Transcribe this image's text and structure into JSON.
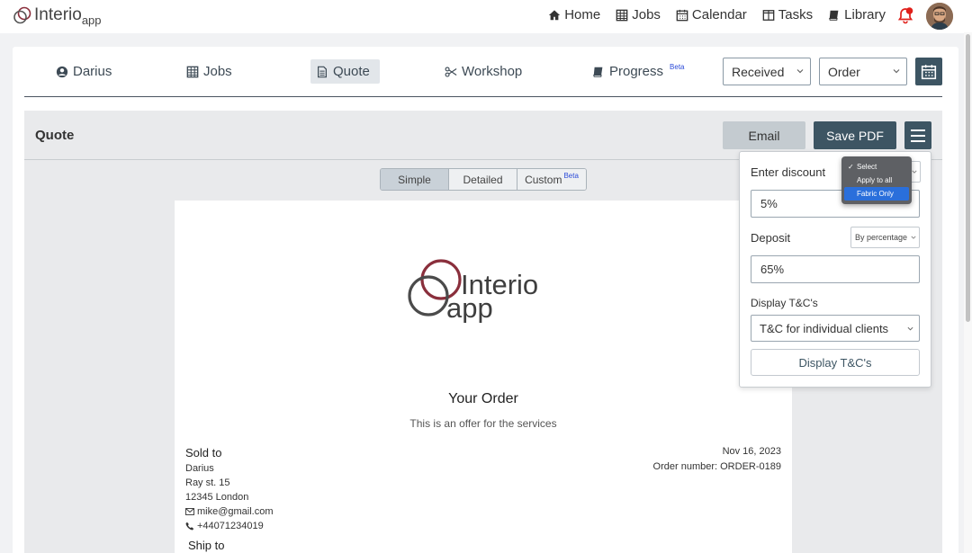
{
  "brand": {
    "name": "Interio",
    "suffix": "app"
  },
  "topnav": [
    {
      "label": "Home",
      "icon": "home-icon"
    },
    {
      "label": "Jobs",
      "icon": "table-icon"
    },
    {
      "label": "Calendar",
      "icon": "calendar-icon"
    },
    {
      "label": "Tasks",
      "icon": "columns-icon"
    },
    {
      "label": "Library",
      "icon": "book-icon"
    }
  ],
  "jobnav": {
    "client": "Darius",
    "jobs": "Jobs",
    "quote": "Quote",
    "workshop": "Workshop",
    "progress": "Progress",
    "beta": "Beta",
    "status_select": "Received",
    "type_select": "Order"
  },
  "quote": {
    "title": "Quote",
    "email_label": "Email",
    "pdf_label": "Save PDF",
    "modes": [
      "Simple",
      "Detailed",
      "Custom"
    ],
    "active_mode": "Simple",
    "custom_beta": "Beta"
  },
  "document": {
    "logo_name": "Interio",
    "logo_suffix": "app",
    "heading": "Your Order",
    "subheading": "This is an offer for the services",
    "sold_to_label": "Sold to",
    "customer_name": "Darius",
    "address_line1": "Ray st. 15",
    "address_line2": "12345 London",
    "email": "mike@gmail.com",
    "phone": "+44071234019",
    "date": "Nov 16, 2023",
    "order_number": "Order number: ORDER-0189",
    "ship_to_label": "Ship to"
  },
  "discount_panel": {
    "discount_label": "Enter discount",
    "discount_value": "5%",
    "deposit_label": "Deposit",
    "deposit_mode": "By percentage",
    "deposit_value": "65%",
    "tc_label": "Display T&C's",
    "tc_select": "T&C for individual clients",
    "tc_button": "Display T&C's"
  },
  "discount_menu": {
    "options": [
      "Select",
      "Apply to all",
      "Fabric Only"
    ],
    "checked": "Select",
    "highlighted": "Fabric Only"
  },
  "colors": {
    "primary": "#3d5563",
    "accent_logo": "#8a2f3c",
    "highlight": "#2a6fdb",
    "notification": "#e0201b"
  }
}
